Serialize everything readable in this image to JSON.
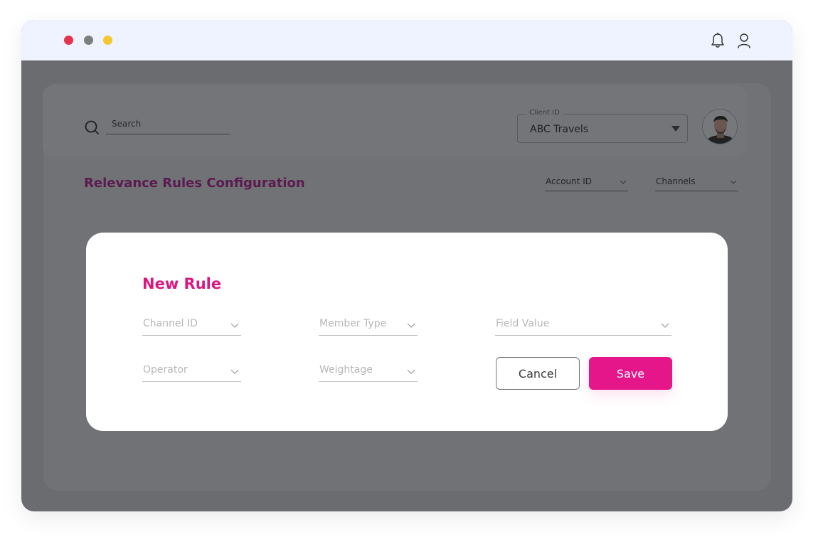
{
  "window": {
    "controls": [
      "close",
      "minimize",
      "maximize"
    ]
  },
  "titlebar": {
    "icons": {
      "notifications": "bell-icon",
      "profile": "user-icon"
    }
  },
  "header": {
    "search": {
      "placeholder": "Search"
    },
    "client_select": {
      "label": "Client ID",
      "value": "ABC Travels"
    },
    "avatar": {
      "name": "user-avatar"
    }
  },
  "page": {
    "title": "Relevance Rules Configuration",
    "filters": {
      "account_id": "Account ID",
      "channels": "Channels"
    }
  },
  "modal": {
    "title": "New Rule",
    "fields": {
      "channel_id": "Channel ID",
      "member_type": "Member Type",
      "field_value": "Field Value",
      "operator": "Operator",
      "weightage": "Weightage"
    },
    "buttons": {
      "cancel": "Cancel",
      "save": "Save"
    }
  },
  "colors": {
    "accent": "#E5158A",
    "title_accent": "#D9197F",
    "overlay": "#6B6C6F",
    "titlebar_bg": "#EEF3FF"
  }
}
